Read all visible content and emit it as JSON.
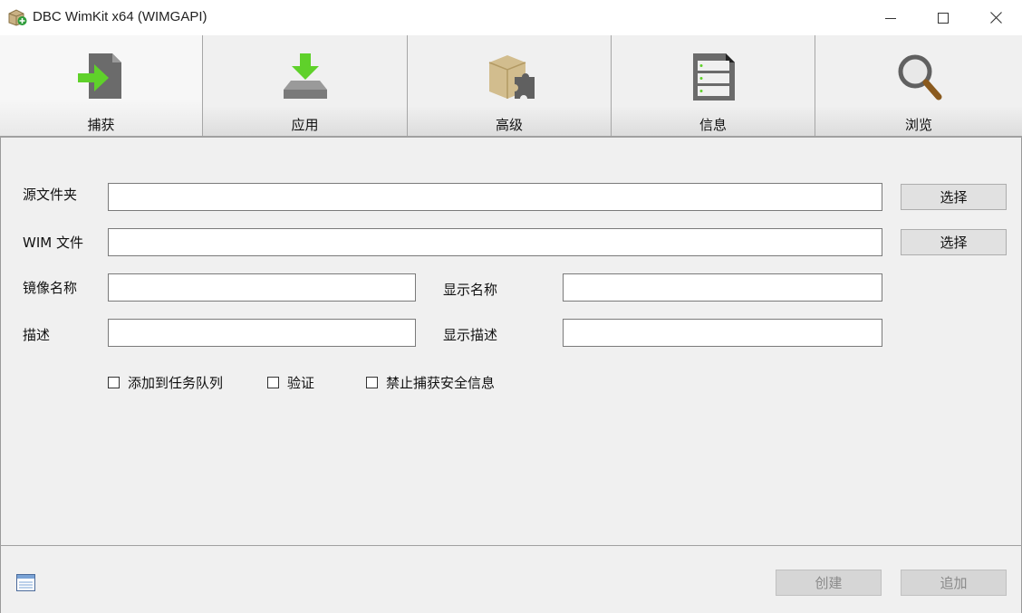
{
  "window": {
    "title": "DBC WimKit x64 (WIMGAPI)",
    "minimize_icon": "minimize-icon",
    "maximize_icon": "maximize-icon",
    "close_icon": "close-icon"
  },
  "toolbar": {
    "tabs": [
      {
        "label": "捕获",
        "icon": "capture-icon",
        "active": true
      },
      {
        "label": "应用",
        "icon": "apply-icon"
      },
      {
        "label": "高级",
        "icon": "advanced-icon"
      },
      {
        "label": "信息",
        "icon": "info-icon"
      },
      {
        "label": "浏览",
        "icon": "browse-icon"
      }
    ]
  },
  "form": {
    "source_folder_label": "源文件夹",
    "source_folder_value": "",
    "wim_file_label": "WIM 文件",
    "wim_file_value": "",
    "select_label": "选择",
    "image_name_label": "镜像名称",
    "image_name_value": "",
    "display_name_label": "显示名称",
    "display_name_value": "",
    "description_label": "描述",
    "description_value": "",
    "display_description_label": "显示描述",
    "display_description_value": "",
    "checkboxes": [
      {
        "label": "添加到任务队列",
        "checked": false
      },
      {
        "label": "验证",
        "checked": false
      },
      {
        "label": "禁止捕获安全信息",
        "checked": false
      }
    ]
  },
  "footer": {
    "create_label": "创建",
    "append_label": "追加",
    "status_icon": "task-list-icon"
  },
  "colors": {
    "accent_green": "#5fd12a",
    "window_bg": "#f0f0f0"
  }
}
